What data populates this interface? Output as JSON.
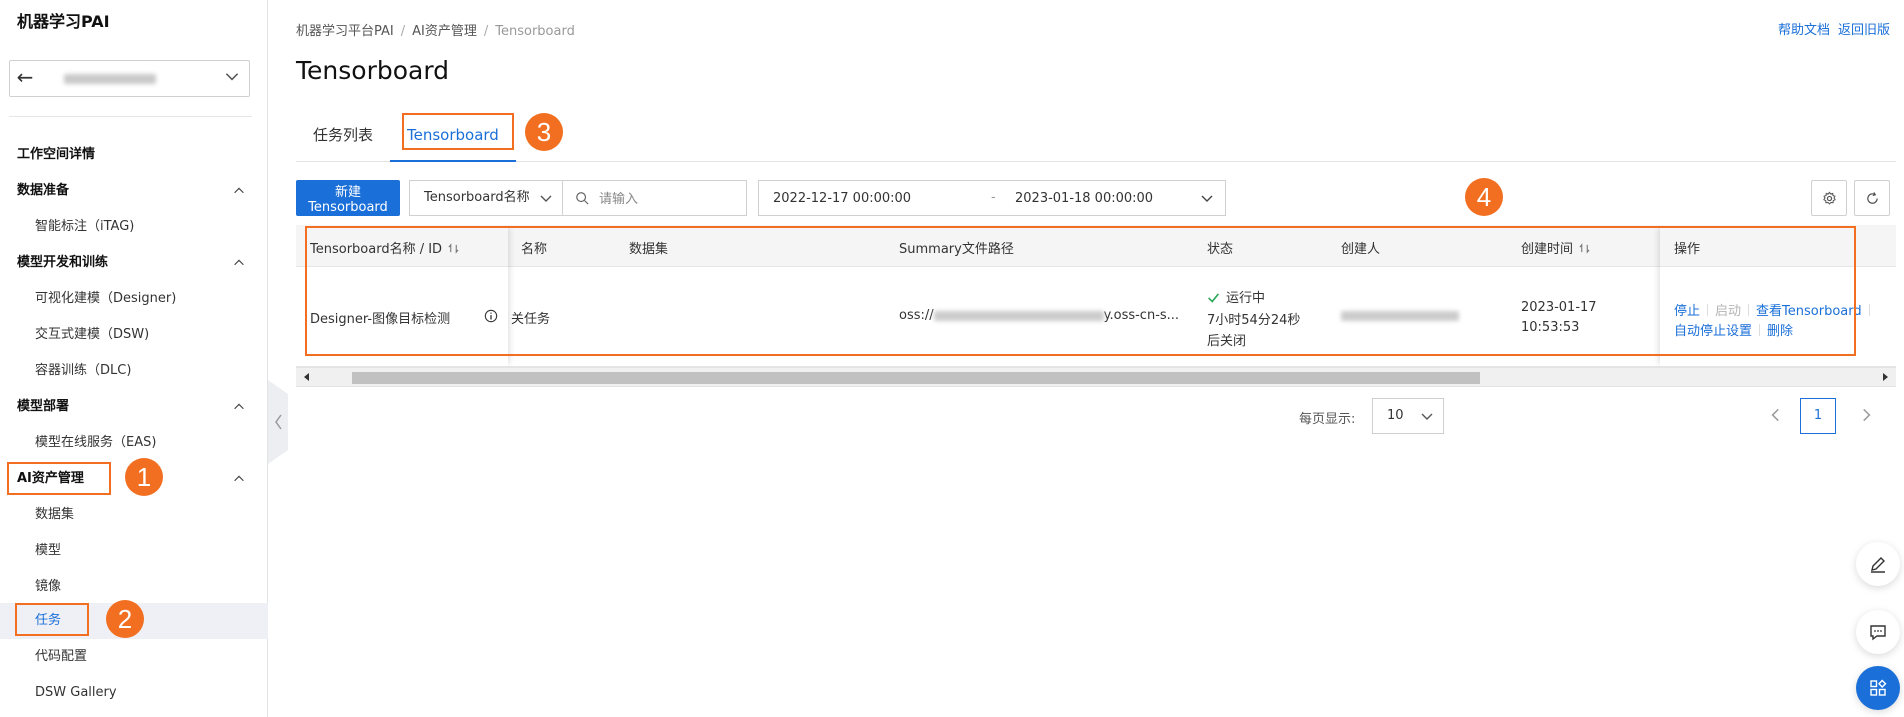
{
  "sidebar": {
    "title": "机器学习PAI",
    "workspace_back": "←",
    "items": [
      {
        "label": "工作空间详情",
        "type": "group",
        "caret": false
      },
      {
        "label": "数据准备",
        "type": "group",
        "caret": true
      },
      {
        "label": "智能标注（iTAG)",
        "type": "sub"
      },
      {
        "label": "模型开发和训练",
        "type": "group",
        "caret": true
      },
      {
        "label": "可视化建模（Designer)",
        "type": "sub"
      },
      {
        "label": "交互式建模（DSW)",
        "type": "sub"
      },
      {
        "label": "容器训练（DLC)",
        "type": "sub"
      },
      {
        "label": "模型部署",
        "type": "group",
        "caret": true
      },
      {
        "label": "模型在线服务（EAS)",
        "type": "sub"
      },
      {
        "label": "AI资产管理",
        "type": "group",
        "caret": true
      },
      {
        "label": "数据集",
        "type": "sub"
      },
      {
        "label": "模型",
        "type": "sub"
      },
      {
        "label": "镜像",
        "type": "sub"
      },
      {
        "label": "任务",
        "type": "sub",
        "active": true
      },
      {
        "label": "代码配置",
        "type": "sub"
      },
      {
        "label": "DSW Gallery",
        "type": "sub"
      }
    ]
  },
  "breadcrumb": [
    "机器学习平台PAI",
    "AI资产管理",
    "Tensorboard"
  ],
  "top_links": {
    "help": "帮助文档",
    "old": "返回旧版"
  },
  "page_title": "Tensorboard",
  "tabs": [
    {
      "label": "任务列表",
      "active": false
    },
    {
      "label": "Tensorboard",
      "active": true
    }
  ],
  "toolbar": {
    "create_button": "新建Tensorboard",
    "filter_field": "Tensorboard名称",
    "search_placeholder": "请输入",
    "date_start": "2022-12-17 00:00:00",
    "date_separator": "-",
    "date_end": "2023-01-18 00:00:00"
  },
  "table": {
    "columns": {
      "name_id": "Tensorboard名称 / ID",
      "task_name": "名称",
      "dataset": "数据集",
      "summary_path": "Summary文件路径",
      "status": "状态",
      "creator": "创建人",
      "created_time": "创建时间",
      "actions": "操作"
    },
    "rows": [
      {
        "name": "Designer-图像目标检测",
        "task_name": "关任务",
        "dataset": "",
        "summary_path_prefix": "oss://",
        "summary_path_suffix": "y.oss-cn-s...",
        "status": "运行中",
        "status_note_1": "7小时54分24秒",
        "status_note_2": "后关闭",
        "created_date": "2023-01-17",
        "created_time": "10:53:53",
        "actions": {
          "stop": "停止",
          "start": "启动",
          "view": "查看Tensorboard",
          "auto_stop": "自动停止设置",
          "delete": "删除"
        }
      }
    ]
  },
  "pagination": {
    "page_size_label": "每页显示:",
    "page_size": "10",
    "current_page": "1"
  },
  "annotations": [
    "1",
    "2",
    "3",
    "4"
  ],
  "colors": {
    "accent": "#1a6fd8",
    "highlight": "#f26f21"
  }
}
